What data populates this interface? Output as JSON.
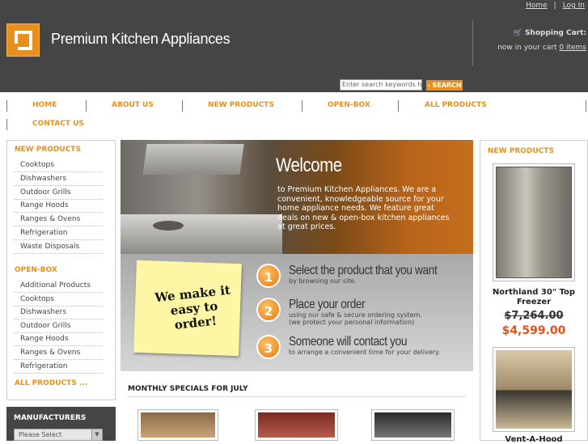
{
  "header": {
    "brand": "Premium Kitchen Appliances",
    "links": [
      "Home",
      "Log In"
    ],
    "cart_title": "Shopping Cart:",
    "cart_text": "now in your cart",
    "cart_items": "0 items",
    "search_placeholder": "Enter search keywords he",
    "search_button": "› SEARCH"
  },
  "nav": [
    "HOME",
    "ABOUT US",
    "NEW PRODUCTS",
    "OPEN-BOX",
    "ALL PRODUCTS",
    "CONTACT US"
  ],
  "sidebar": {
    "new_products": {
      "title": "NEW PRODUCTS",
      "items": [
        "Cooktops",
        "Dishwashers",
        "Outdoor Grills",
        "Range Hoods",
        "Ranges & Ovens",
        "Refrigeration",
        "Waste Disposals"
      ]
    },
    "open_box": {
      "title": "OPEN-BOX",
      "items": [
        "Additional Products",
        "Cooktops",
        "Dishwashers",
        "Outdoor Grills",
        "Range Hoods",
        "Ranges & Ovens",
        "Refrigeration"
      ]
    },
    "all_products": "ALL PRODUCTS ...",
    "manufacturers": "MANUFACTURERS",
    "manufacturer_select": "Please Select"
  },
  "banner": {
    "welcome": "Welcome",
    "text": "to Premium Kitchen Appliances. We are a convenient, knowledgeable source for your home appliance needs. We feature great deals on new & open-box kitchen appliances at great prices.",
    "note": "We make it easy to order!",
    "steps": [
      {
        "num": "1",
        "title": "Select the product that you want",
        "sub": "by browsing our site."
      },
      {
        "num": "2",
        "title": "Place your order",
        "sub": "using our safe & secure ordering system.\n(we protect your personal information)"
      },
      {
        "num": "3",
        "title": "Someone will contact you",
        "sub": "to arrange a convenient time for your delivery."
      }
    ]
  },
  "specials_title": "MONTHLY SPECIALS FOR JULY",
  "right": {
    "title": "NEW PRODUCTS",
    "product1": {
      "name": "Northland 30\" Top Freezer",
      "old_price": "$7,264.00",
      "price": "$4,599.00"
    },
    "product2": {
      "name": "Vent-A-Hood"
    }
  },
  "colors": {
    "accent": "#e8901e",
    "header_bg": "#454545",
    "sale": "#e8501a"
  }
}
